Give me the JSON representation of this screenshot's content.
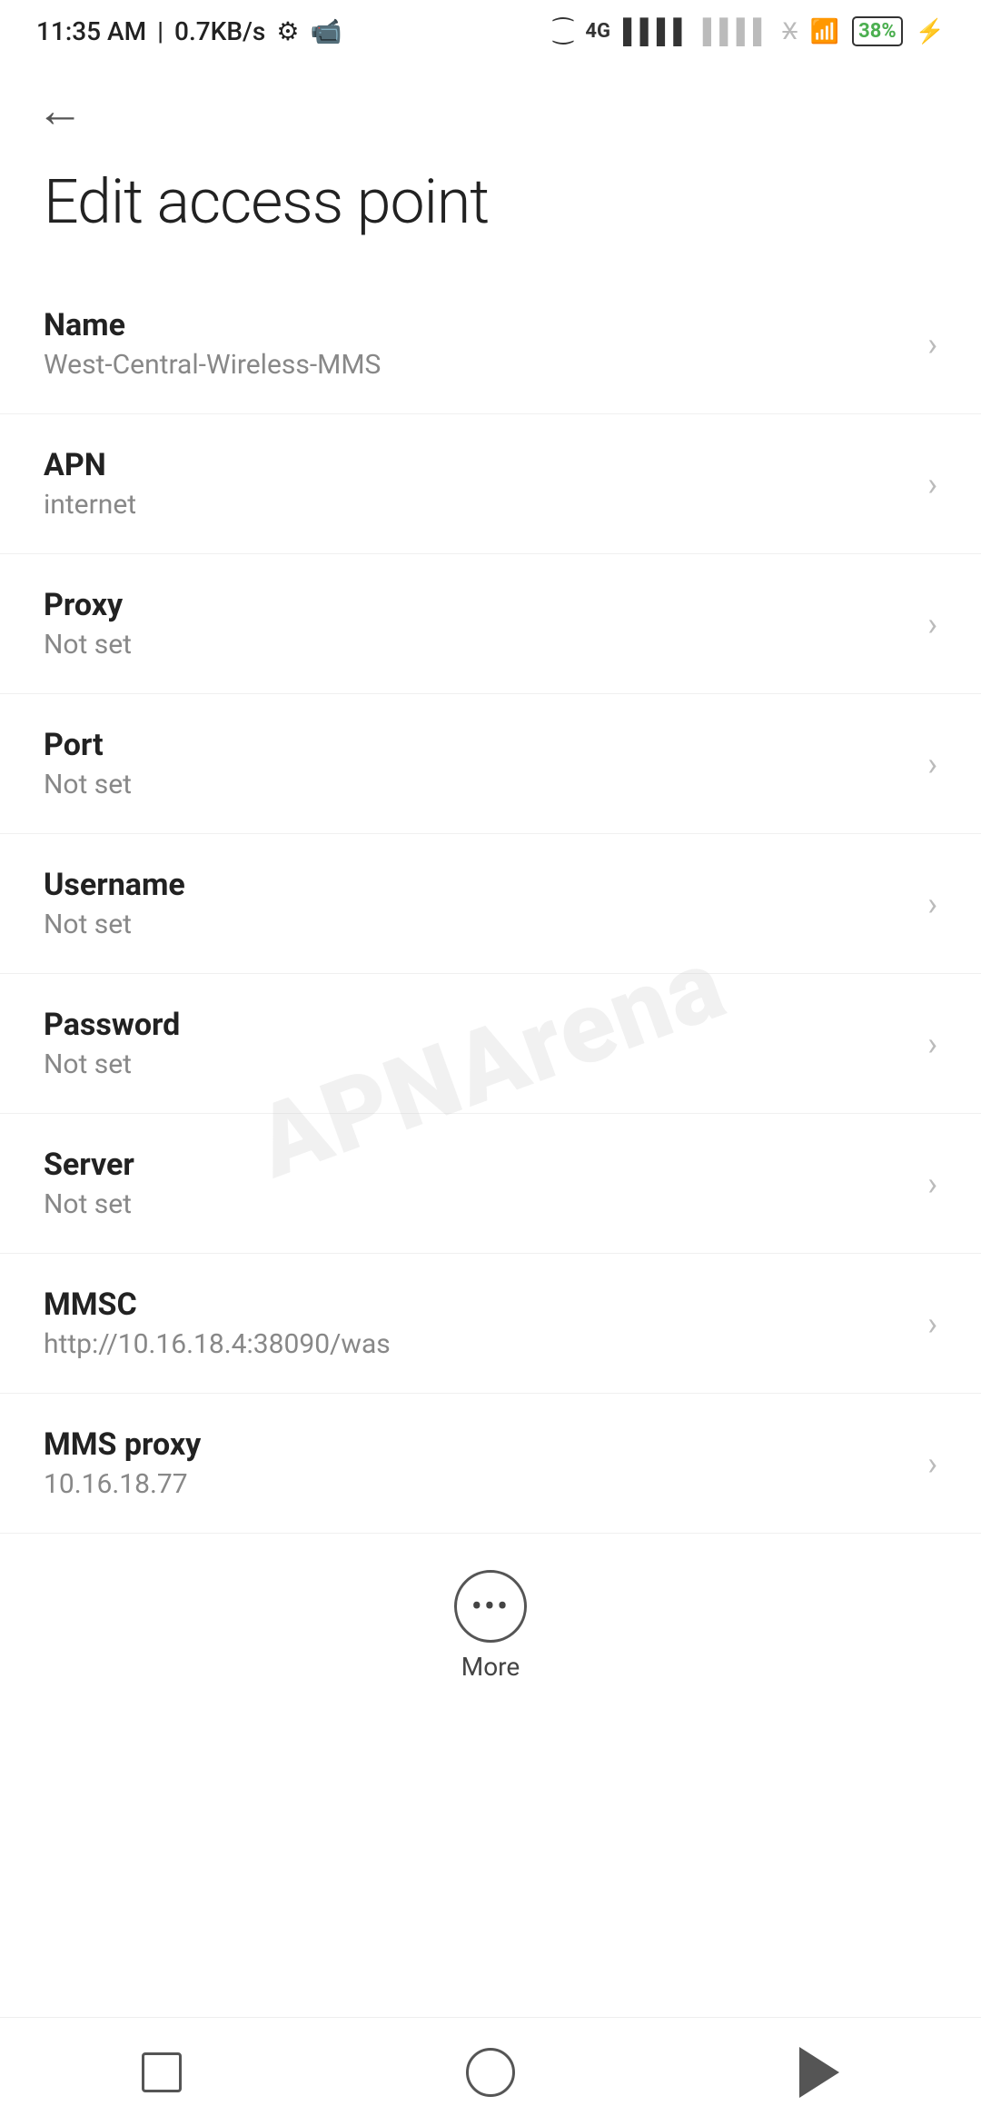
{
  "statusBar": {
    "time": "11:35 AM",
    "speed": "0.7KB/s",
    "battery": "38"
  },
  "page": {
    "title": "Edit access point",
    "back_label": "←"
  },
  "fields": [
    {
      "label": "Name",
      "value": "West-Central-Wireless-MMS"
    },
    {
      "label": "APN",
      "value": "internet"
    },
    {
      "label": "Proxy",
      "value": "Not set"
    },
    {
      "label": "Port",
      "value": "Not set"
    },
    {
      "label": "Username",
      "value": "Not set"
    },
    {
      "label": "Password",
      "value": "Not set"
    },
    {
      "label": "Server",
      "value": "Not set"
    },
    {
      "label": "MMSC",
      "value": "http://10.16.18.4:38090/was"
    },
    {
      "label": "MMS proxy",
      "value": "10.16.18.77"
    }
  ],
  "more": {
    "label": "More"
  },
  "watermark": "APNArena"
}
